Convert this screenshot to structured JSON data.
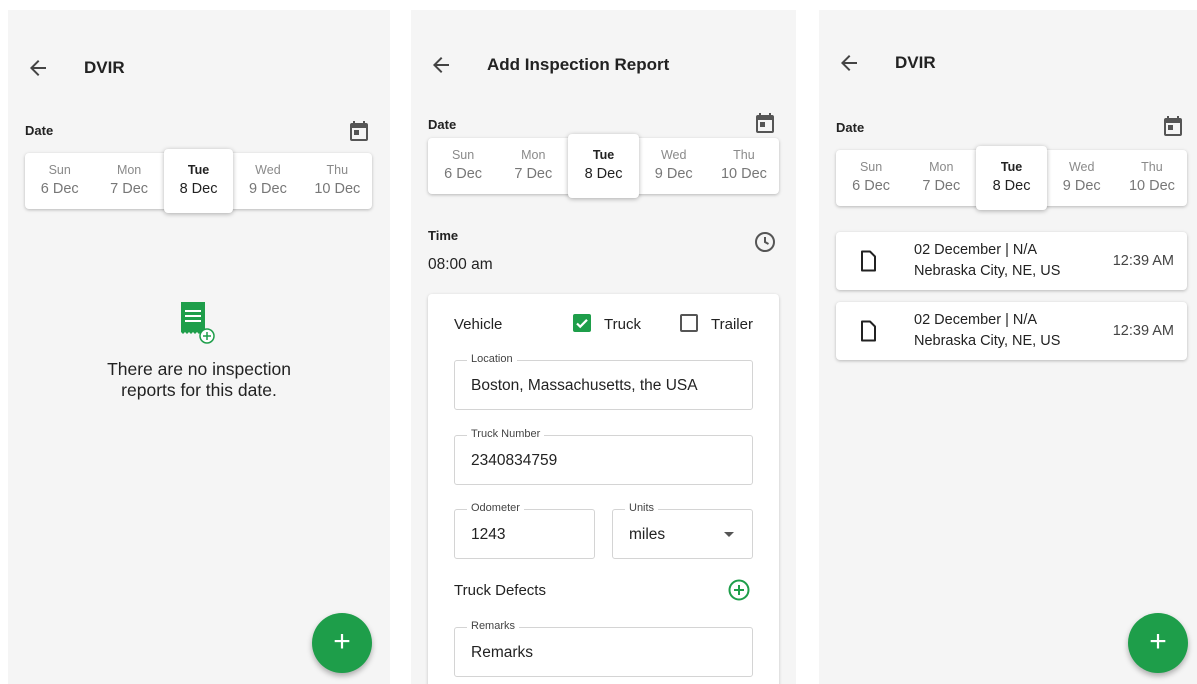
{
  "screens": {
    "empty": {
      "title": "DVIR",
      "date_label": "Date",
      "days": [
        {
          "dow": "Sun",
          "date": "6 Dec"
        },
        {
          "dow": "Mon",
          "date": "7 Dec"
        },
        {
          "dow": "Tue",
          "date": "8 Dec"
        },
        {
          "dow": "Wed",
          "date": "9 Dec"
        },
        {
          "dow": "Thu",
          "date": "10 Dec"
        }
      ],
      "selected_day": "Tue",
      "empty_line1": "There are no inspection",
      "empty_line2": "reports for this date.",
      "fab": "+"
    },
    "add_report": {
      "title": "Add Inspection Report",
      "date_label": "Date",
      "days": [
        {
          "dow": "Sun",
          "date": "6 Dec"
        },
        {
          "dow": "Mon",
          "date": "7 Dec"
        },
        {
          "dow": "Tue",
          "date": "8 Dec"
        },
        {
          "dow": "Wed",
          "date": "9 Dec"
        },
        {
          "dow": "Thu",
          "date": "10 Dec"
        }
      ],
      "time_label": "Time",
      "time_value": "08:00 am",
      "vehicle_label": "Vehicle",
      "truck_label": "Truck",
      "truck_checked": true,
      "trailer_label": "Trailer",
      "trailer_checked": false,
      "location_label": "Location",
      "location_value": "Boston, Massachusetts, the USA",
      "truck_number_label": "Truck Number",
      "truck_number_value": "2340834759",
      "odometer_label": "Odometer",
      "odometer_value": "1243",
      "units_label": "Units",
      "units_value": "miles",
      "defects_label": "Truck Defects",
      "remarks_label": "Remarks",
      "remarks_placeholder": "Remarks"
    },
    "list": {
      "title": "DVIR",
      "date_label": "Date",
      "days": [
        {
          "dow": "Sun",
          "date": "6 Dec"
        },
        {
          "dow": "Mon",
          "date": "7 Dec"
        },
        {
          "dow": "Tue",
          "date": "8 Dec"
        },
        {
          "dow": "Wed",
          "date": "9 Dec"
        },
        {
          "dow": "Thu",
          "date": "10 Dec"
        }
      ],
      "reports": [
        {
          "title": "02 December | N/A",
          "location": "Nebraska City, NE, US",
          "time": "12:39 AM"
        },
        {
          "title": "02 December | N/A",
          "location": "Nebraska City, NE, US",
          "time": "12:39 AM"
        }
      ],
      "fab": "+"
    }
  },
  "colors": {
    "accent": "#1e9e4a",
    "panel_bg": "#f5f5f5",
    "icon": "#555555"
  }
}
